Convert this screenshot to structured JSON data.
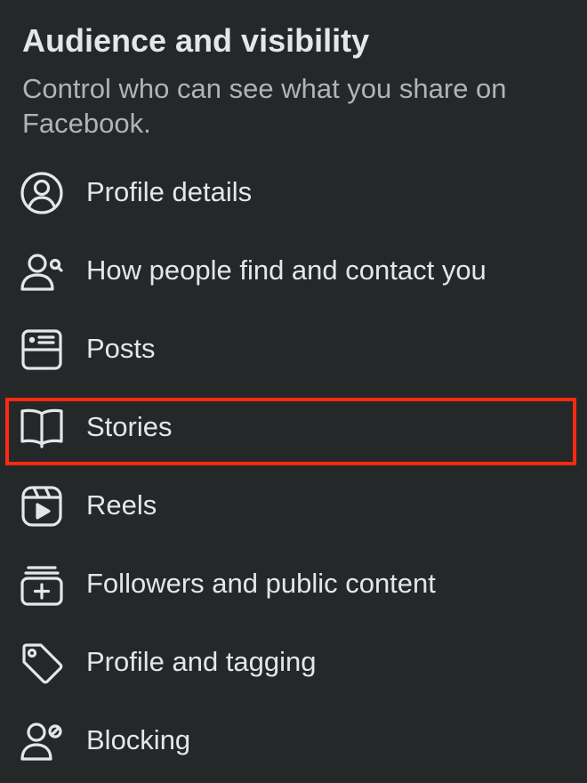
{
  "header": {
    "title": "Audience and visibility",
    "subtitle": "Control who can see what you share on Facebook."
  },
  "colors": {
    "background": "#252829",
    "text_primary": "#e4e6eb",
    "text_secondary": "#b0b3b8",
    "highlight": "#ff2a10"
  },
  "menu": {
    "items": [
      {
        "label": "Profile details",
        "icon": "person-circle-icon"
      },
      {
        "label": "How people find and contact you",
        "icon": "person-search-icon"
      },
      {
        "label": "Posts",
        "icon": "posts-icon"
      },
      {
        "label": "Stories",
        "icon": "book-icon"
      },
      {
        "label": "Reels",
        "icon": "reels-icon"
      },
      {
        "label": "Followers and public content",
        "icon": "followers-stack-icon",
        "highlighted": true
      },
      {
        "label": "Profile and tagging",
        "icon": "tag-icon"
      },
      {
        "label": "Blocking",
        "icon": "person-block-icon"
      }
    ]
  }
}
